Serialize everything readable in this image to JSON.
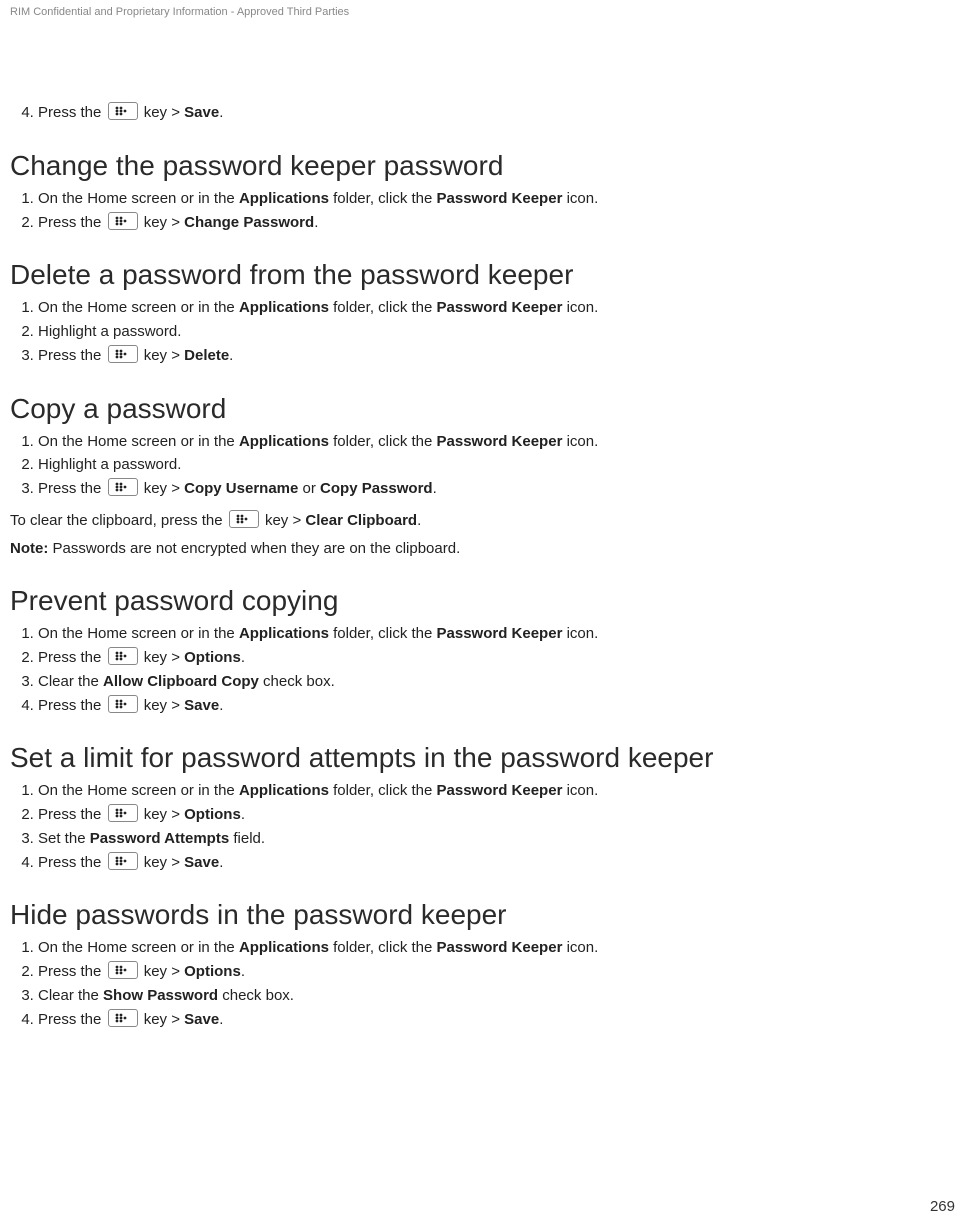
{
  "header": "RIM Confidential and Proprietary Information - Approved Third Parties",
  "page_number": "269",
  "intro_step": {
    "num": "4.",
    "pre": "Press the ",
    "post": " key > ",
    "action": "Save",
    "end": "."
  },
  "sections": [
    {
      "title": "Change the password keeper password",
      "steps": [
        {
          "num": "1.",
          "text_pre": "On the Home screen or in the ",
          "b1": "Applications",
          "mid": " folder, click the ",
          "b2": "Password Keeper",
          "end": " icon."
        },
        {
          "num": "2.",
          "key": true,
          "pre": "Press the ",
          "post": " key > ",
          "action": "Change Password",
          "end": "."
        }
      ]
    },
    {
      "title": "Delete a password from the password keeper",
      "steps": [
        {
          "num": "1.",
          "text_pre": "On the Home screen or in the ",
          "b1": "Applications",
          "mid": " folder, click the ",
          "b2": "Password Keeper",
          "end": " icon."
        },
        {
          "num": "2.",
          "plain": "Highlight a password."
        },
        {
          "num": "3.",
          "key": true,
          "pre": "Press the ",
          "post": " key > ",
          "action": "Delete",
          "end": "."
        }
      ]
    },
    {
      "title": "Copy a password",
      "steps": [
        {
          "num": "1.",
          "text_pre": "On the Home screen or in the ",
          "b1": "Applications",
          "mid": " folder, click the ",
          "b2": "Password Keeper",
          "end": " icon."
        },
        {
          "num": "2.",
          "plain": "Highlight a password."
        },
        {
          "num": "3.",
          "key": true,
          "pre": "Press the ",
          "post": " key > ",
          "action": "Copy Username",
          "mid2": " or ",
          "action2": "Copy Password",
          "end": "."
        }
      ],
      "after": {
        "clip_pre": "To clear the clipboard, press the ",
        "clip_post": " key > ",
        "clip_action": "Clear Clipboard",
        "clip_end": ".",
        "note_label": "Note:",
        "note_text": " Passwords are not encrypted when they are on the clipboard."
      }
    },
    {
      "title": "Prevent password copying",
      "steps": [
        {
          "num": "1.",
          "text_pre": "On the Home screen or in the ",
          "b1": "Applications",
          "mid": " folder, click the ",
          "b2": "Password Keeper",
          "end": " icon."
        },
        {
          "num": "2.",
          "key": true,
          "pre": "Press the ",
          "post": " key > ",
          "action": "Options",
          "end": "."
        },
        {
          "num": "3.",
          "plain_pre": "Clear the ",
          "plain_b": "Allow Clipboard Copy",
          "plain_post": " check box."
        },
        {
          "num": "4.",
          "key": true,
          "pre": "Press the ",
          "post": " key > ",
          "action": "Save",
          "end": "."
        }
      ]
    },
    {
      "title": "Set a limit for password attempts in the password keeper",
      "steps": [
        {
          "num": "1.",
          "text_pre": "On the Home screen or in the ",
          "b1": "Applications",
          "mid": " folder, click the ",
          "b2": "Password Keeper",
          "end": " icon."
        },
        {
          "num": "2.",
          "key": true,
          "pre": "Press the ",
          "post": " key > ",
          "action": "Options",
          "end": "."
        },
        {
          "num": "3.",
          "plain_pre": "Set the ",
          "plain_b": "Password Attempts",
          "plain_post": " field."
        },
        {
          "num": "4.",
          "key": true,
          "pre": "Press the ",
          "post": " key > ",
          "action": "Save",
          "end": "."
        }
      ]
    },
    {
      "title": "Hide passwords in the password keeper",
      "steps": [
        {
          "num": "1.",
          "text_pre": "On the Home screen or in the ",
          "b1": "Applications",
          "mid": " folder, click the ",
          "b2": "Password Keeper",
          "end": " icon."
        },
        {
          "num": "2.",
          "key": true,
          "pre": "Press the ",
          "post": " key > ",
          "action": "Options",
          "end": "."
        },
        {
          "num": "3.",
          "plain_pre": "Clear the ",
          "plain_b": "Show Password",
          "plain_post": " check box."
        },
        {
          "num": "4.",
          "key": true,
          "pre": "Press the ",
          "post": " key > ",
          "action": "Save",
          "end": "."
        }
      ]
    }
  ]
}
